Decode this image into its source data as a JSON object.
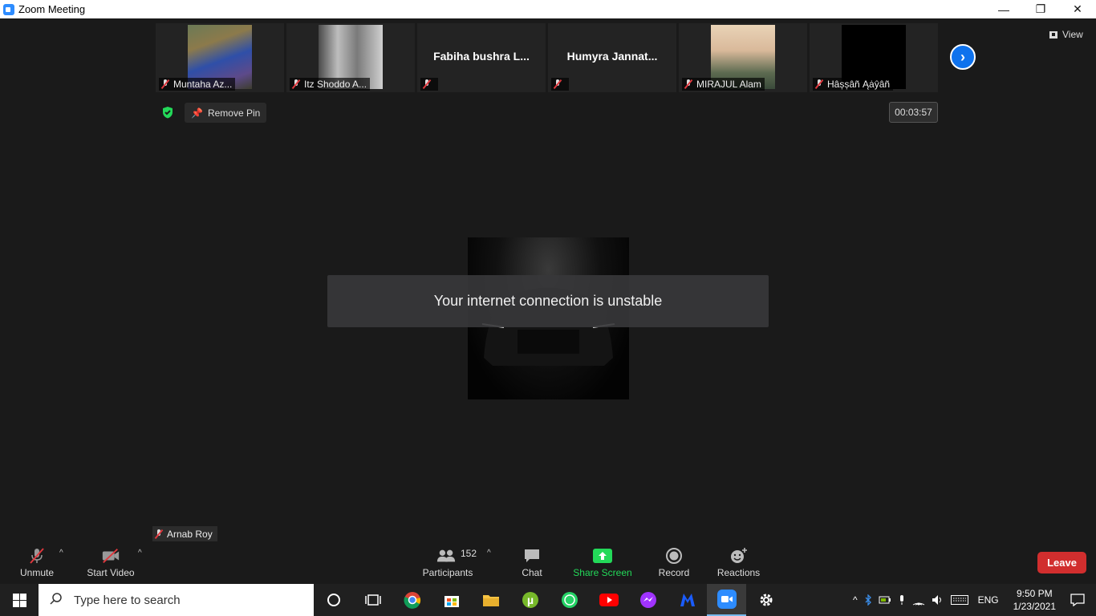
{
  "window": {
    "title": "Zoom Meeting",
    "minimize": "—",
    "restore": "❐",
    "close": "✕"
  },
  "participants_strip": [
    {
      "name": "Muntaha Az...",
      "kind": "photo",
      "muted": true
    },
    {
      "name": "Itz Shoddo A...",
      "kind": "photo",
      "muted": true
    },
    {
      "name": "Fabiha bushra L...",
      "kind": "name",
      "muted": true
    },
    {
      "name": "Humyra  Jannat...",
      "kind": "name",
      "muted": true
    },
    {
      "name": "MIRAJUL Alam",
      "kind": "photo",
      "muted": true
    },
    {
      "name": "Hâșșâñ Ąȧŷâñ",
      "kind": "black",
      "muted": true
    }
  ],
  "view_button": "View",
  "remove_pin": "Remove Pin",
  "timer": "00:03:57",
  "toast": "Your internet connection is unstable",
  "self_label": "Arnab Roy",
  "toolbar": {
    "unmute": "Unmute",
    "start_video": "Start Video",
    "participants": "Participants",
    "participants_count": "152",
    "chat": "Chat",
    "share_screen": "Share Screen",
    "record": "Record",
    "reactions": "Reactions",
    "leave": "Leave"
  },
  "taskbar": {
    "search_placeholder": "Type here to search",
    "language": "ENG",
    "time": "9:50 PM",
    "date": "1/23/2021"
  },
  "colors": {
    "accent": "#2d8cff",
    "share_green": "#23d959",
    "leave_red": "#d12e2e",
    "muted_red": "#e0383e"
  },
  "icons": [
    "zoom-icon",
    "mic-off-icon",
    "video-off-icon",
    "participants-icon",
    "chat-icon",
    "share-screen-icon",
    "record-icon",
    "reactions-icon",
    "windows-start-icon",
    "search-icon",
    "chrome-icon",
    "store-icon",
    "folder-icon",
    "utorrent-icon",
    "whatsapp-icon",
    "youtube-icon",
    "messenger-icon",
    "malwarebytes-icon",
    "zoom-taskbar-icon",
    "settings-icon"
  ]
}
